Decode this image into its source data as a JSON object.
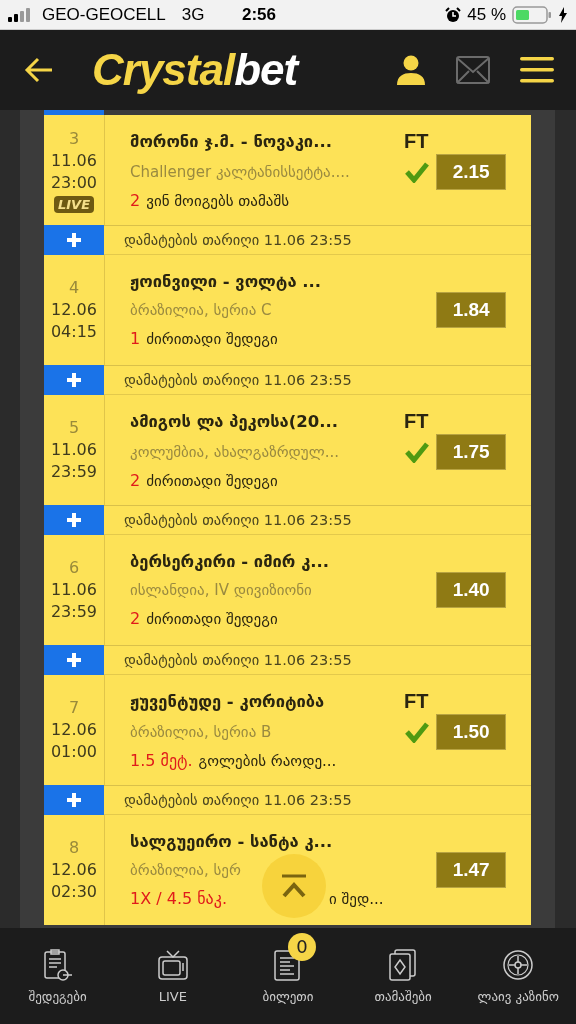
{
  "status_bar": {
    "carrier": "GEO-GEOCELL",
    "network": "3G",
    "time": "2:56",
    "battery": "45 %"
  },
  "header": {
    "logo_main": "Crystal",
    "logo_accent": "bet"
  },
  "bets": [
    {
      "number": "3",
      "date": "11.06",
      "time": "23:00",
      "live": true,
      "live_label": "LIVE",
      "title": "მორონი ჯ.მ. - ნოვაკი...",
      "status": "FT",
      "league": "Challenger კალტანისსეტტა....",
      "pick_value": "2",
      "pick_label": "ვინ მოიგებს თამაშს",
      "won": true,
      "odds": "2.15",
      "covered": false
    },
    {
      "added": "დამატების თარიღი 11.06 23:55",
      "number": "4",
      "date": "12.06",
      "time": "04:15",
      "live": false,
      "title": "ჟოინვილი - ვოლტა ...",
      "league": "ბრაზილია, სერია C",
      "pick_value": "1",
      "pick_label": "ძირითადი შედეგი",
      "won": false,
      "odds": "1.84",
      "covered": false
    },
    {
      "added": "დამატების თარიღი 11.06 23:55",
      "number": "5",
      "date": "11.06",
      "time": "23:59",
      "live": false,
      "title": "ამიგოს ლა პეკოსა(20...",
      "status": "FT",
      "league": "კოლუმბია, ახალგაზრდულ...",
      "pick_value": "2",
      "pick_label": "ძირითადი შედეგი",
      "won": true,
      "odds": "1.75",
      "covered": false
    },
    {
      "added": "დამატების თარიღი 11.06 23:55",
      "number": "6",
      "date": "11.06",
      "time": "23:59",
      "live": false,
      "title": "ბერსერკირი - იმირ კ...",
      "league": "ისლანდია, IV დივიზიონი",
      "pick_value": "2",
      "pick_label": "ძირითადი შედეგი",
      "won": false,
      "odds": "1.40",
      "covered": false
    },
    {
      "added": "დამატების თარიღი 11.06 23:55",
      "number": "7",
      "date": "12.06",
      "time": "01:00",
      "live": false,
      "title": "ჟუვენტუდე - კორიტიბა",
      "status": "FT",
      "league": "ბრაზილია, სერია B",
      "pick_value": "1.5 მეტ.",
      "pick_label": "გოლების რაოდე...",
      "won": true,
      "odds": "1.50",
      "covered": false
    },
    {
      "added": "დამატების თარიღი 11.06 23:55",
      "number": "8",
      "date": "12.06",
      "time": "02:30",
      "live": false,
      "title": "სალგუეირო - სანტა კ...",
      "league": "ბრაზილია, სერ",
      "pick_value": "1X / 4.5 ნაკ.",
      "pick_label": "ი შედ...",
      "won": false,
      "odds": "1.47",
      "covered": true
    }
  ],
  "bottom_nav": [
    {
      "kind": "results",
      "label": "შედეგები"
    },
    {
      "kind": "live",
      "label": "LIVE"
    },
    {
      "kind": "ticket",
      "label": "ბილეთი",
      "badge": "0"
    },
    {
      "kind": "games",
      "label": "თამაშები"
    },
    {
      "kind": "casino",
      "label": "ლაივ კაზინო"
    }
  ]
}
